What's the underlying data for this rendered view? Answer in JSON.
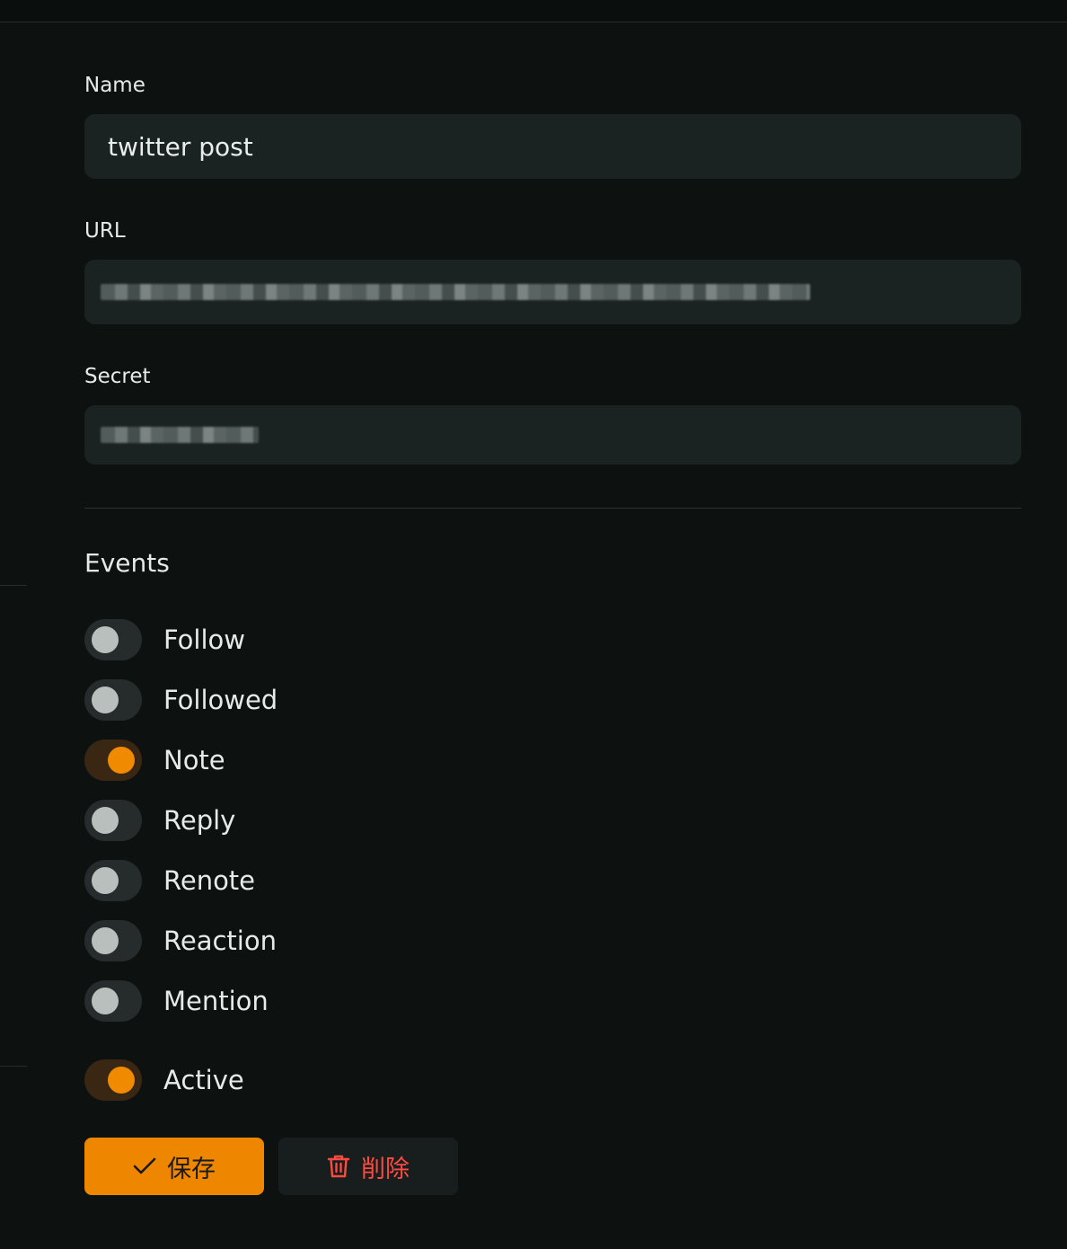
{
  "form": {
    "name_label": "Name",
    "name_value": "twitter post",
    "url_label": "URL",
    "secret_label": "Secret"
  },
  "events": {
    "title": "Events",
    "items": [
      {
        "label": "Follow",
        "on": false
      },
      {
        "label": "Followed",
        "on": false
      },
      {
        "label": "Note",
        "on": true
      },
      {
        "label": "Reply",
        "on": false
      },
      {
        "label": "Renote",
        "on": false
      },
      {
        "label": "Reaction",
        "on": false
      },
      {
        "label": "Mention",
        "on": false
      }
    ]
  },
  "active": {
    "label": "Active",
    "on": true
  },
  "actions": {
    "save_label": "保存",
    "delete_label": "削除",
    "save_icon": "check-icon",
    "delete_icon": "trash-icon"
  },
  "colors": {
    "accent": "#ef8600",
    "danger": "#ff4a40",
    "background": "#0d1211",
    "field": "#1b2322"
  }
}
